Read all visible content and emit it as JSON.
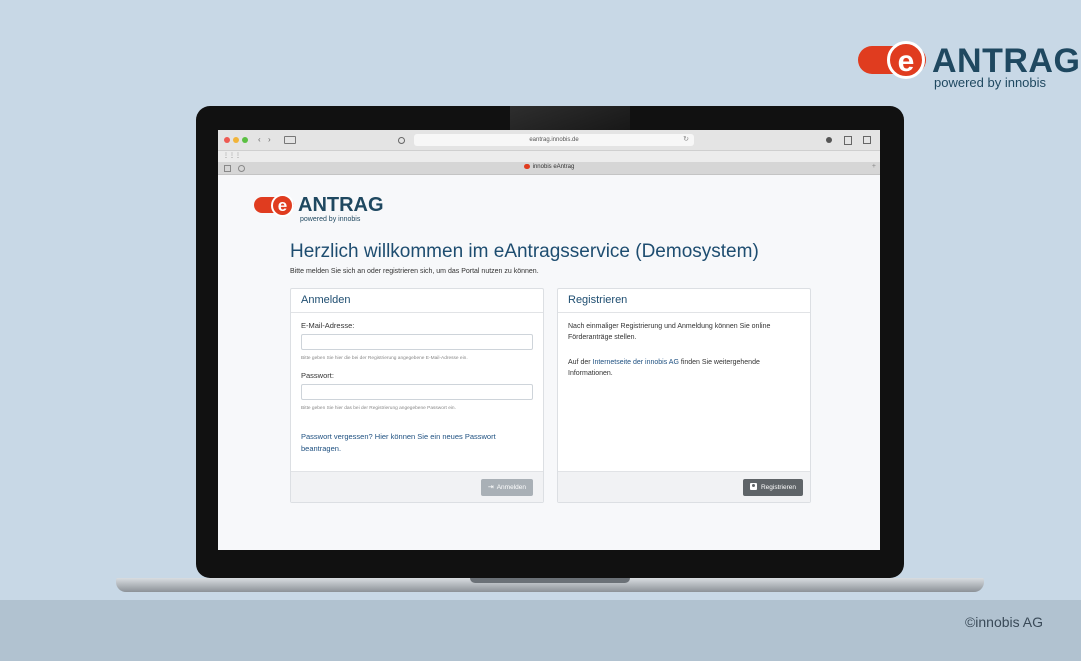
{
  "brand": {
    "e": "e",
    "name": "ANTRAG",
    "tagline": "powered by innobis"
  },
  "copyright": "©innobis AG",
  "browser": {
    "url": "eantrag.innobis.de",
    "tab_title": "innobis eAntrag",
    "reload_glyph": "↻",
    "nav_back": "‹",
    "nav_forward": "›",
    "bookmarks_glyph": "⋮⋮⋮"
  },
  "page": {
    "logo": {
      "e": "e",
      "name": "ANTRAG",
      "tagline": "powered by innobis"
    },
    "title": "Herzlich willkommen im eAntragsservice (Demosystem)",
    "intro": "Bitte melden Sie sich an oder registrieren sich, um das Portal nutzen zu können.",
    "login": {
      "title": "Anmelden",
      "email_label": "E-Mail-Adresse:",
      "email_value": "",
      "email_help": "Bitte geben Sie hier die bei der Registrierung angegebene E-Mail-Adresse ein.",
      "password_label": "Passwort:",
      "password_value": "",
      "password_help": "Bitte geben Sie hier das bei der Registrierung angegebene Passwort ein.",
      "forgot_link": "Passwort vergessen? Hier können Sie ein neues Passwort beantragen.",
      "button": "Anmelden",
      "button_icon": "⇥"
    },
    "register": {
      "title": "Registrieren",
      "text1": "Nach einmaliger Registrierung und Anmeldung können Sie online Förderanträge stellen.",
      "text2_before": "Auf der ",
      "text2_link": "Internetseite der innobis AG",
      "text2_after": " finden Sie weitergehende Informationen.",
      "button": "Registrieren"
    }
  },
  "colors": {
    "brand_red": "#e03c1f",
    "brand_navy": "#1f4860",
    "heading_blue": "#1e4d70",
    "link_blue": "#1e5080"
  }
}
